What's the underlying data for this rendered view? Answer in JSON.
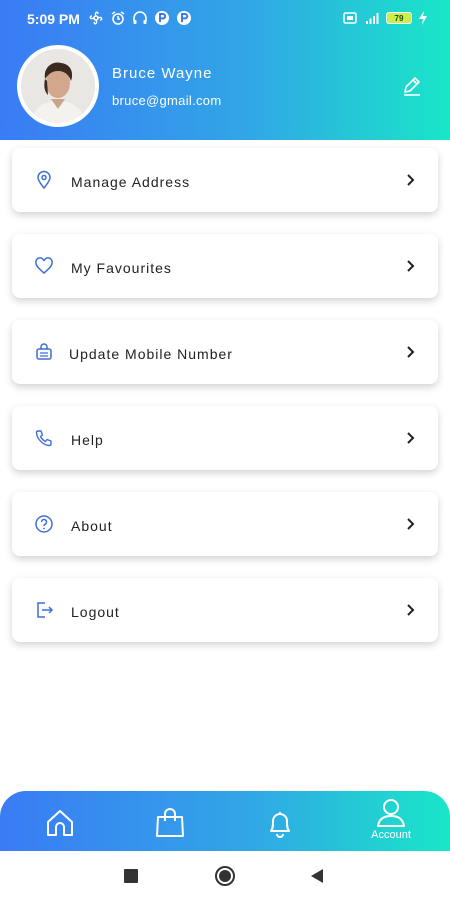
{
  "status_bar": {
    "time": "5:09 PM",
    "battery": "79",
    "left_icons": [
      "fan-icon",
      "alarm-icon",
      "headset-icon",
      "p-app-icon",
      "p-app-icon"
    ],
    "right_icons": [
      "sim-icon",
      "signal-icon",
      "battery-icon",
      "charging-icon"
    ]
  },
  "profile": {
    "name": "Bruce Wayne",
    "email": "bruce@gmail.com",
    "edit_icon": "edit-pencil-icon"
  },
  "menu": {
    "items": [
      {
        "label": "Manage Address",
        "icon": "location-pin-icon"
      },
      {
        "label": "My Favourites",
        "icon": "heart-icon"
      },
      {
        "label": "Update Mobile Number",
        "icon": "phone-device-icon"
      },
      {
        "label": "Help",
        "icon": "phone-call-icon"
      },
      {
        "label": "About",
        "icon": "question-circle-icon"
      },
      {
        "label": "Logout",
        "icon": "logout-icon"
      }
    ]
  },
  "bottom_nav": {
    "items": [
      {
        "icon": "home-icon"
      },
      {
        "icon": "shopping-bag-icon"
      },
      {
        "icon": "bell-icon"
      },
      {
        "icon": "user-icon",
        "label": "Account",
        "active": true
      }
    ]
  },
  "colors": {
    "gradient_start": "#3a7bf5",
    "gradient_end": "#19e6c8",
    "icon_blue": "#3f6fd8"
  }
}
